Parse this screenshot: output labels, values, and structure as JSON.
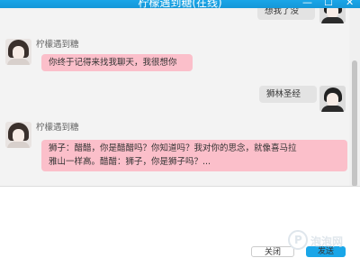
{
  "window": {
    "title": "柠檬遇到糖(在线)",
    "controls": {
      "minimize": "—",
      "maximize": "☐",
      "close": "✕"
    }
  },
  "messages": [
    {
      "side": "right",
      "text": "想我了没"
    },
    {
      "side": "left",
      "sender": "柠檬遇到糖",
      "text": "你终于记得来找我聊天，我很想你"
    },
    {
      "side": "right",
      "text": "狮林圣经"
    },
    {
      "side": "left",
      "sender": "柠檬遇到糖",
      "text_line1": "狮子：醋醋，你是醋醋吗？你知道吗？我对你的思念，就像喜马拉",
      "text_line2": "雅山一样高。醋醋：狮子，你是狮子吗？..."
    }
  ],
  "buttons": {
    "close_label": "关闭",
    "send_label": "发送"
  },
  "watermark": {
    "mark": "P",
    "text": "泡泡网"
  },
  "colors": {
    "accent": "#1aa6e8",
    "bubble_received": "#fbbfca",
    "bubble_sent": "#e3e3e3"
  }
}
